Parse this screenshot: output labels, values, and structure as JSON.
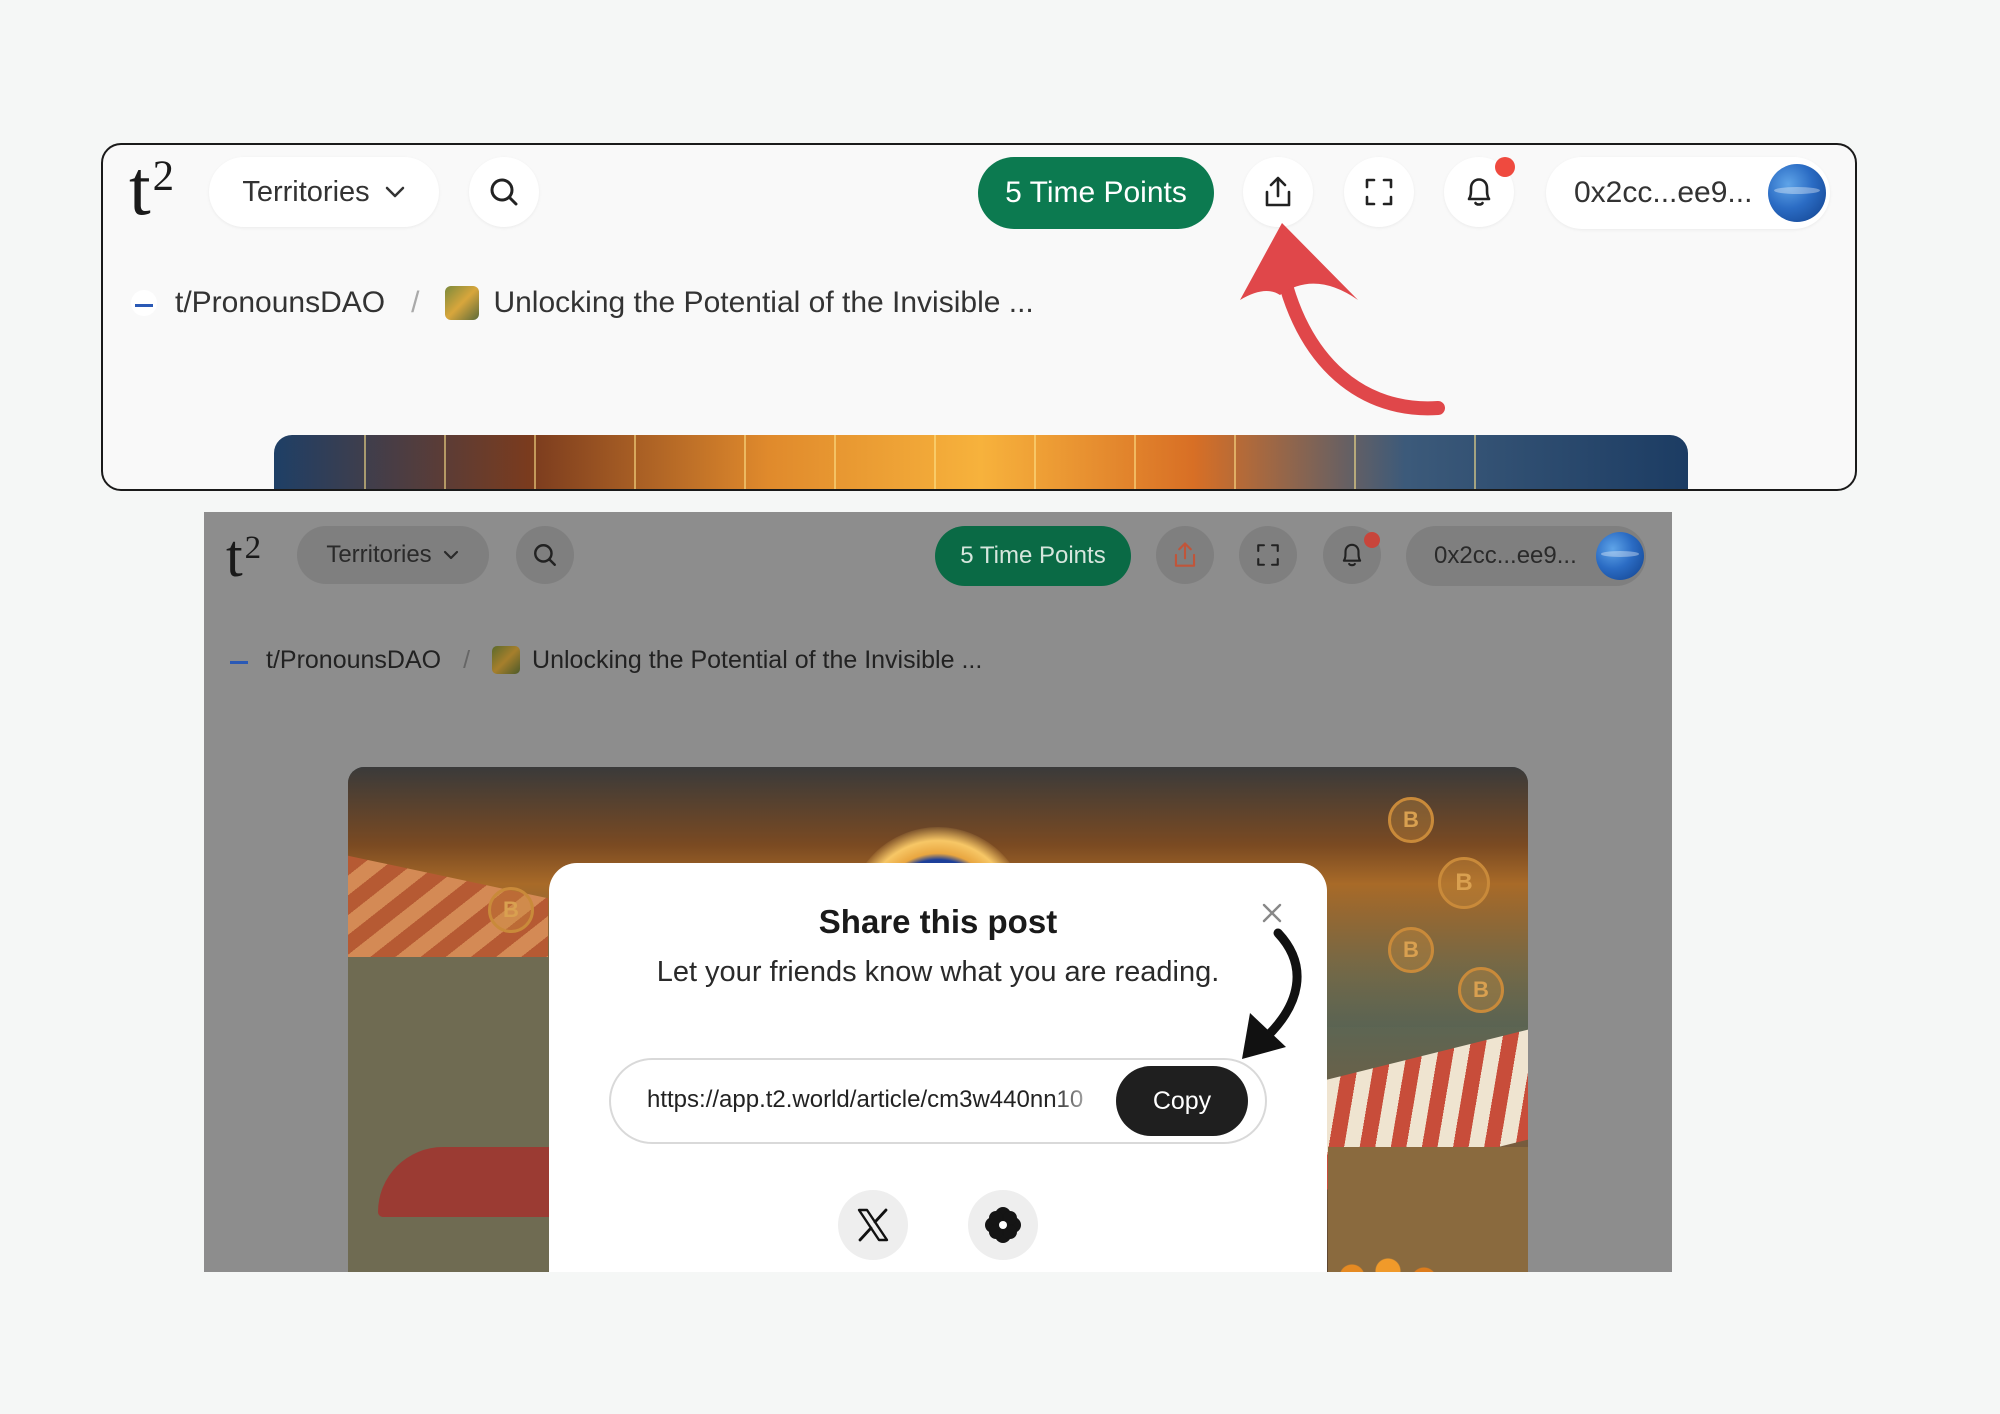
{
  "header": {
    "logo_text": "t",
    "logo_sup": "2",
    "territories_label": "Territories",
    "time_points_label": "5 Time Points",
    "wallet_label": "0x2cc...ee9..."
  },
  "breadcrumb": {
    "territory": "t/PronounsDAO",
    "separator": "/",
    "article": "Unlocking the Potential of the Invisible ..."
  },
  "modal": {
    "title": "Share this post",
    "subtitle": "Let your friends know what you are reading.",
    "url": "https://app.t2.world/article/cm3w440nn10",
    "copy_label": "Copy"
  },
  "illustration": {
    "coin_letter": "B"
  },
  "icons": [
    "search-icon",
    "chevron-down-icon",
    "share-icon",
    "fullscreen-icon",
    "bell-icon",
    "close-icon",
    "x-logo-icon",
    "flower-icon"
  ],
  "colors": {
    "primary_green": "#0c7a50",
    "notification_red": "#ef4a3f",
    "arrow_red": "#e0474a",
    "copy_button": "#1f1f1f"
  }
}
